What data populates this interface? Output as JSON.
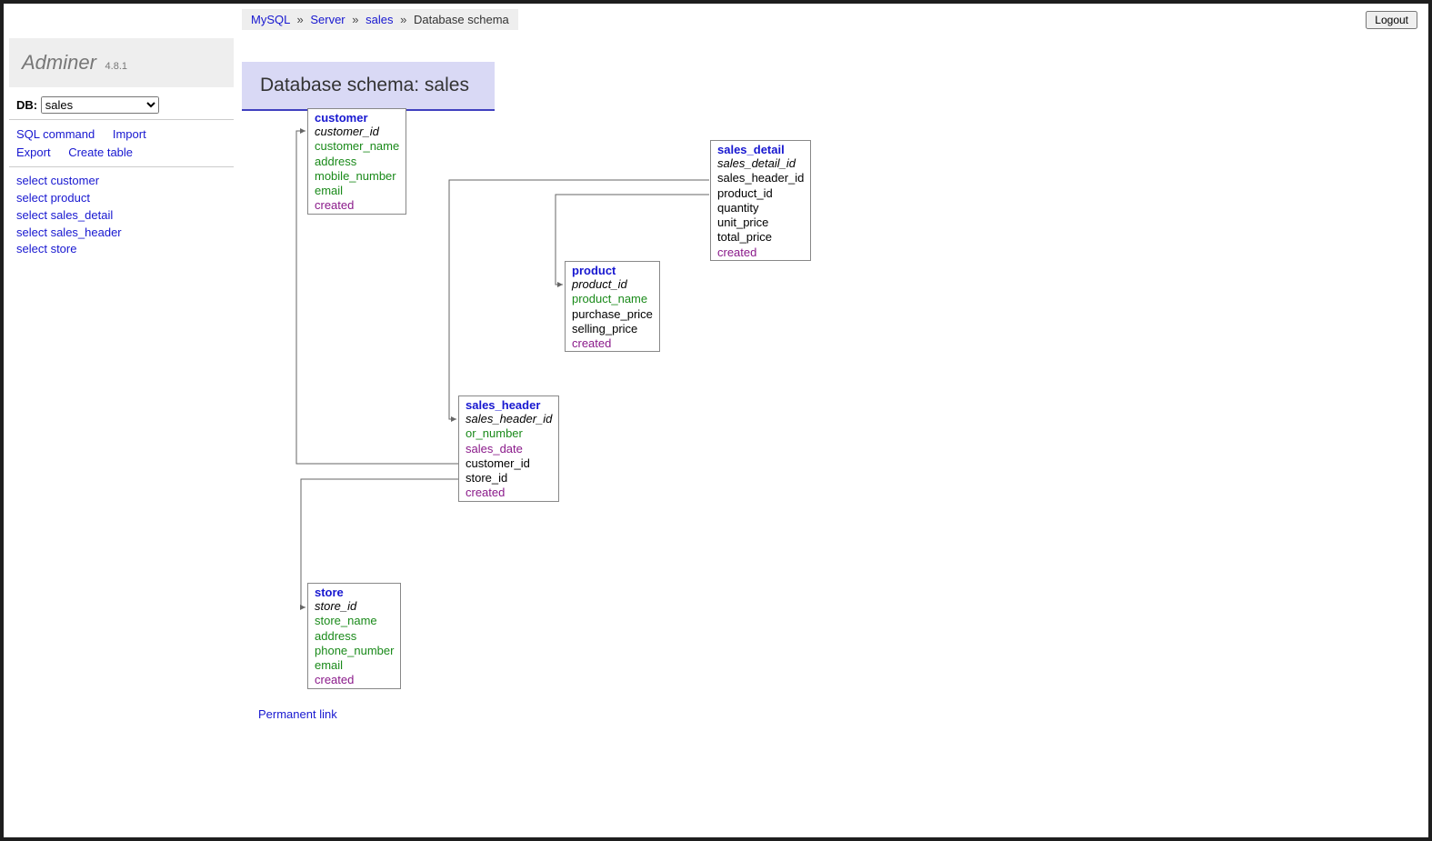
{
  "app": {
    "name": "Adminer",
    "version": "4.8.1"
  },
  "breadcrumbs": {
    "driver": "MySQL",
    "server": "Server",
    "db": "sales",
    "current": "Database schema"
  },
  "logout": "Logout",
  "sidebar": {
    "db_label": "DB:",
    "db_selected": "sales",
    "tools": {
      "sql": "SQL command",
      "import": "Import",
      "export": "Export",
      "create": "Create table"
    },
    "tables": [
      "select customer",
      "select product",
      "select sales_detail",
      "select sales_header",
      "select store"
    ]
  },
  "title": "Database schema: sales",
  "permanent_link": "Permanent link",
  "schema": {
    "customer": {
      "name": "customer",
      "cols": [
        {
          "n": "customer_id",
          "c": "pk"
        },
        {
          "n": "customer_name",
          "c": "uniq"
        },
        {
          "n": "address",
          "c": "uniq"
        },
        {
          "n": "mobile_number",
          "c": "uniq"
        },
        {
          "n": "email",
          "c": "uniq"
        },
        {
          "n": "created",
          "c": "dt"
        }
      ]
    },
    "sales_detail": {
      "name": "sales_detail",
      "cols": [
        {
          "n": "sales_detail_id",
          "c": "pk"
        },
        {
          "n": "sales_header_id",
          "c": ""
        },
        {
          "n": "product_id",
          "c": ""
        },
        {
          "n": "quantity",
          "c": ""
        },
        {
          "n": "unit_price",
          "c": ""
        },
        {
          "n": "total_price",
          "c": ""
        },
        {
          "n": "created",
          "c": "dt"
        }
      ]
    },
    "product": {
      "name": "product",
      "cols": [
        {
          "n": "product_id",
          "c": "pk"
        },
        {
          "n": "product_name",
          "c": "uniq"
        },
        {
          "n": "purchase_price",
          "c": ""
        },
        {
          "n": "selling_price",
          "c": ""
        },
        {
          "n": "created",
          "c": "dt"
        }
      ]
    },
    "sales_header": {
      "name": "sales_header",
      "cols": [
        {
          "n": "sales_header_id",
          "c": "pk"
        },
        {
          "n": "or_number",
          "c": "uniq"
        },
        {
          "n": "sales_date",
          "c": "dt"
        },
        {
          "n": "customer_id",
          "c": ""
        },
        {
          "n": "store_id",
          "c": ""
        },
        {
          "n": "created",
          "c": "dt"
        }
      ]
    },
    "store": {
      "name": "store",
      "cols": [
        {
          "n": "store_id",
          "c": "pk"
        },
        {
          "n": "store_name",
          "c": "uniq"
        },
        {
          "n": "address",
          "c": "uniq"
        },
        {
          "n": "phone_number",
          "c": "uniq"
        },
        {
          "n": "email",
          "c": "uniq"
        },
        {
          "n": "created",
          "c": "dt"
        }
      ]
    }
  }
}
